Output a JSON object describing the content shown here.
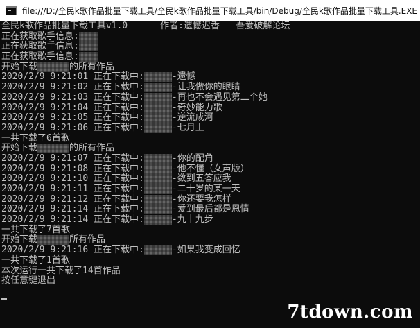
{
  "window": {
    "title": "file:///D:/全民k歌作品批量下载工具/全民k歌作品批量下载工具/bin/Debug/全民k歌作品批量下载工具.EXE",
    "icon": "console-window-icon"
  },
  "console": {
    "lines": [
      {
        "pre": "全民k歌作品批量下载工具v1.0      作者:遗憾迟香   吾爱破解论坛",
        "masked": false,
        "post": ""
      },
      {
        "pre": "正在获取歌手信息:",
        "masked": true,
        "mask_size": "sm",
        "post": ""
      },
      {
        "pre": "正在获取歌手信息:",
        "masked": true,
        "mask_size": "sm",
        "post": ""
      },
      {
        "pre": "正在获取歌手信息:",
        "masked": true,
        "mask_size": "sm",
        "post": ""
      },
      {
        "pre": "开始下载",
        "masked": true,
        "mask_size": "lg",
        "post": "的所有作品"
      },
      {
        "pre": "2020/2/9 9:21:01 正在下载中:",
        "masked": true,
        "mask_size": "md",
        "post": "-遗憾"
      },
      {
        "pre": "2020/2/9 9:21:02 正在下载中:",
        "masked": true,
        "mask_size": "md",
        "post": "-让我做你的眼睛"
      },
      {
        "pre": "2020/2/9 9:21:03 正在下载中:",
        "masked": true,
        "mask_size": "md",
        "post": "-再也不会遇见第二个她"
      },
      {
        "pre": "2020/2/9 9:21:04 正在下载中:",
        "masked": true,
        "mask_size": "md",
        "post": "-奇妙能力歌"
      },
      {
        "pre": "2020/2/9 9:21:05 正在下载中:",
        "masked": true,
        "mask_size": "md",
        "post": "-逆流成河"
      },
      {
        "pre": "2020/2/9 9:21:06 正在下载中:",
        "masked": true,
        "mask_size": "md",
        "post": "-七月上"
      },
      {
        "pre": "一共下载了6首歌",
        "masked": false,
        "post": ""
      },
      {
        "pre": "开始下载",
        "masked": true,
        "mask_size": "lg",
        "post": "的所有作品"
      },
      {
        "pre": "2020/2/9 9:21:07 正在下载中:",
        "masked": true,
        "mask_size": "md",
        "post": "-你的配角"
      },
      {
        "pre": "2020/2/9 9:21:08 正在下载中:",
        "masked": true,
        "mask_size": "md",
        "post": "-他不懂（女声版）"
      },
      {
        "pre": "2020/2/9 9:21:10 正在下载中:",
        "masked": true,
        "mask_size": "md",
        "post": "-数到五答应我"
      },
      {
        "pre": "2020/2/9 9:21:11 正在下载中:",
        "masked": true,
        "mask_size": "md",
        "post": "-二十岁的某一天"
      },
      {
        "pre": "2020/2/9 9:21:12 正在下载中:",
        "masked": true,
        "mask_size": "md",
        "post": "-你还要我怎样"
      },
      {
        "pre": "2020/2/9 9:21:14 正在下载中:",
        "masked": true,
        "mask_size": "md",
        "post": "-爱到最后都是恩情"
      },
      {
        "pre": "2020/2/9 9:21:14 正在下载中:",
        "masked": true,
        "mask_size": "md",
        "post": "-九十九步"
      },
      {
        "pre": "一共下载了7首歌",
        "masked": false,
        "post": ""
      },
      {
        "pre": "开始下载",
        "masked": true,
        "mask_size": "lg",
        "post": "所有作品"
      },
      {
        "pre": "2020/2/9 9:21:16 正在下载中:",
        "masked": true,
        "mask_size": "md",
        "post": "-如果我变成回忆"
      },
      {
        "pre": "一共下载了1首歌",
        "masked": false,
        "post": ""
      },
      {
        "pre": "本次运行一共下载了14首作品",
        "masked": false,
        "post": ""
      },
      {
        "pre": "按任意键退出",
        "masked": false,
        "post": ""
      }
    ]
  },
  "watermark": {
    "text": "7tdown.com"
  },
  "colors": {
    "console_bg": "#0c0c0c",
    "console_text": "#c0c0c0",
    "titlebar_bg": "#ffffff"
  }
}
